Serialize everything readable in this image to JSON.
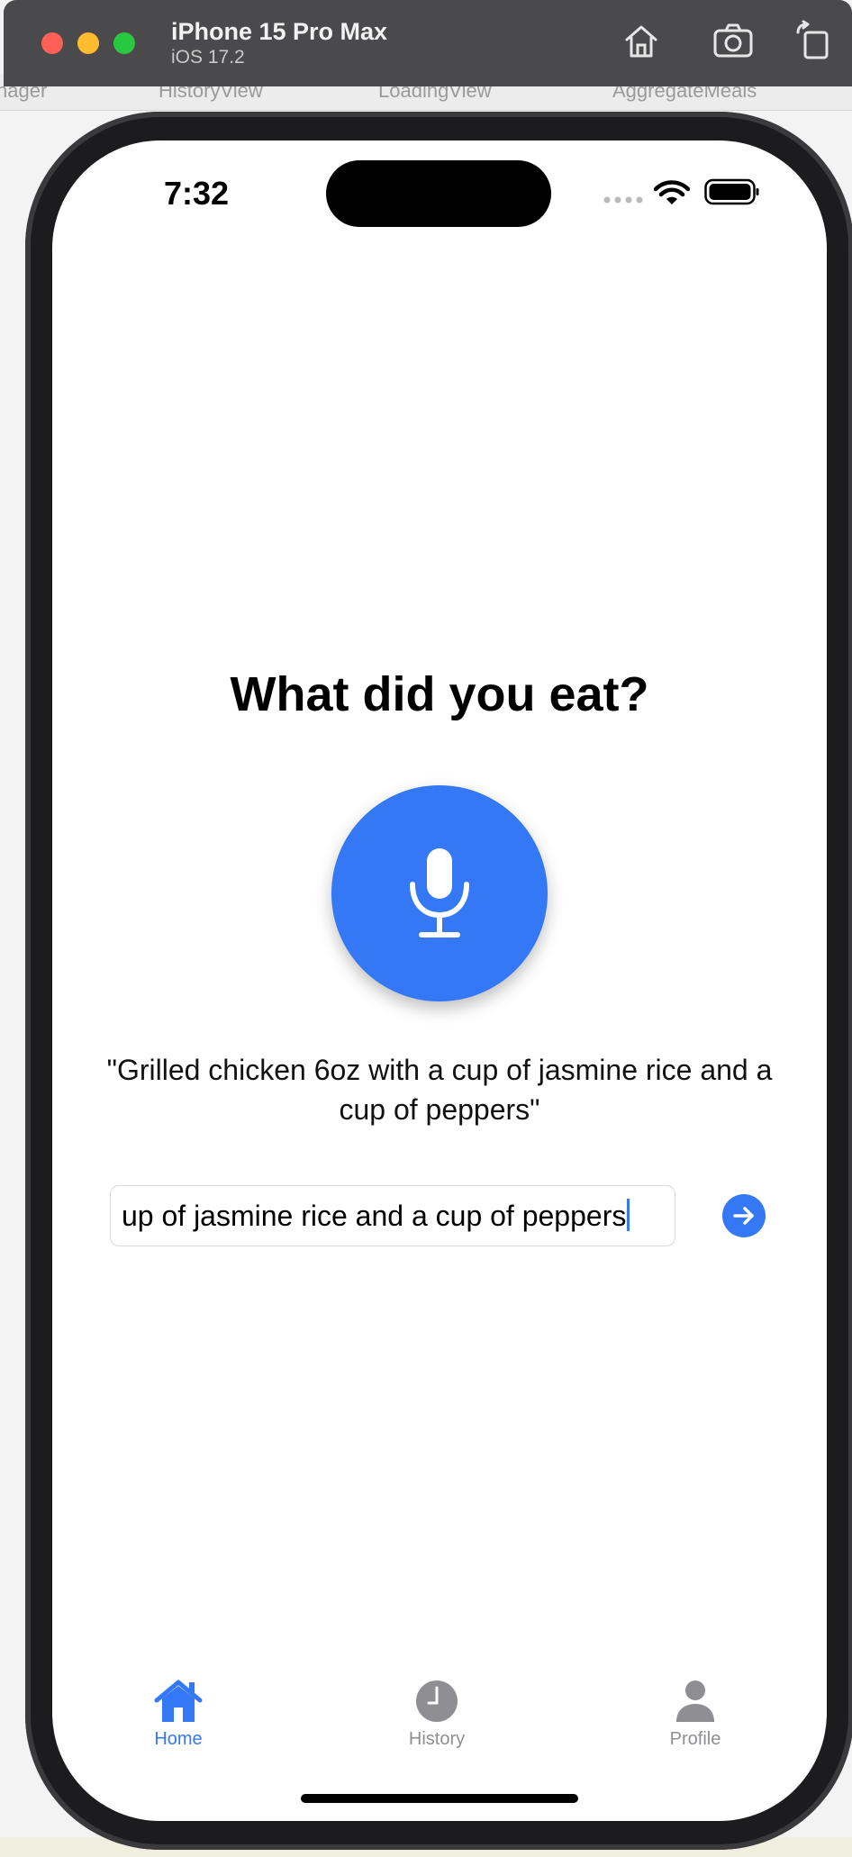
{
  "simulator": {
    "device_name": "iPhone 15 Pro Max",
    "os_version": "iOS 17.2",
    "buttons": [
      "home-icon",
      "screenshot-icon",
      "rotate-icon"
    ]
  },
  "background": {
    "tabs": [
      "nager",
      "HistoryView",
      "LoadingView",
      "AggregateMeals"
    ]
  },
  "status_bar": {
    "time": "7:32"
  },
  "main": {
    "headline": "What did you eat?",
    "mic_icon": "microphone-icon",
    "example_text": "\"Grilled chicken 6oz with a cup of jasmine rice and a cup of peppers\"",
    "input_value": "up of jasmine rice and a cup of peppers",
    "send_icon": "arrow-right-circle-icon"
  },
  "tab_bar": {
    "items": [
      {
        "label": "Home",
        "icon": "house-icon",
        "selected": true
      },
      {
        "label": "History",
        "icon": "clock-icon",
        "selected": false
      },
      {
        "label": "Profile",
        "icon": "person-icon",
        "selected": false
      }
    ]
  },
  "colors": {
    "accent": "#3478f6",
    "inactive": "#8e8e93"
  }
}
